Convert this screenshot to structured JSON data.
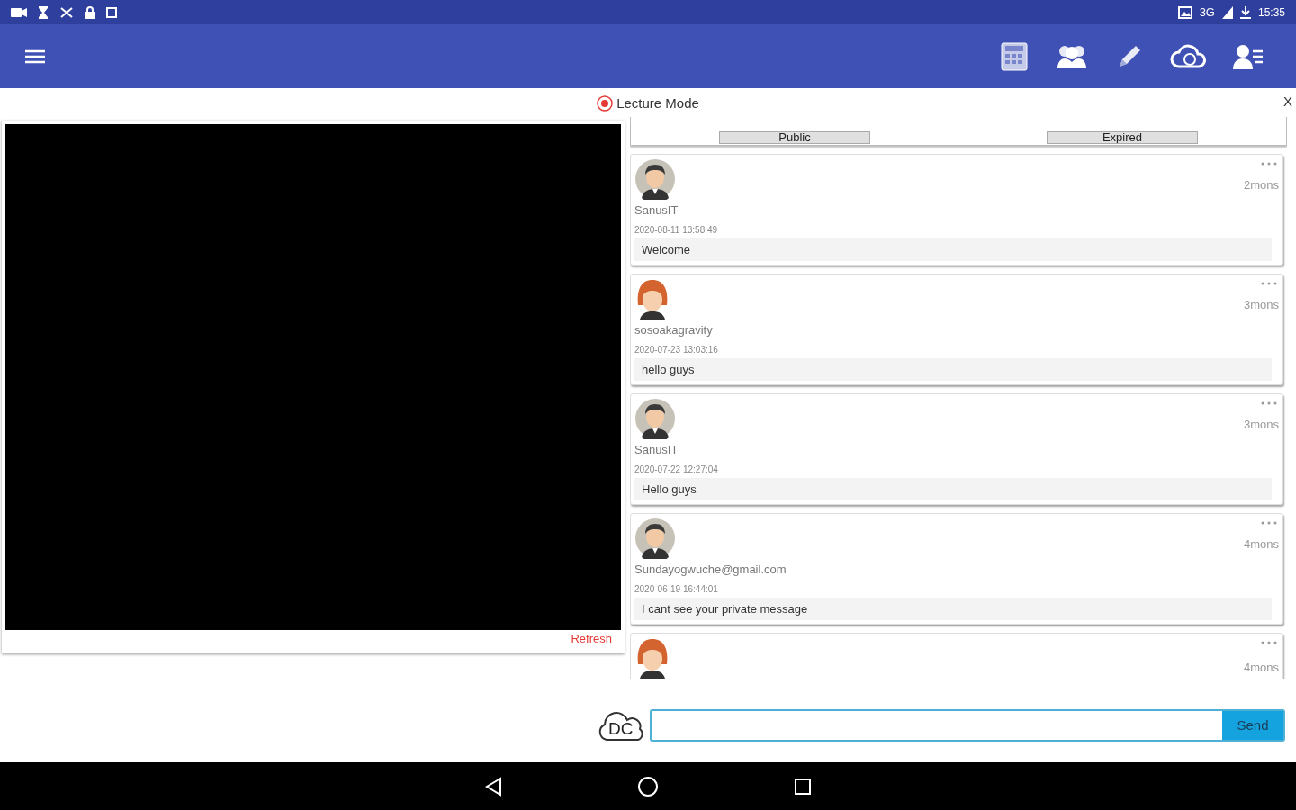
{
  "status_bar": {
    "network": "3G",
    "time": "15:35"
  },
  "dialog": {
    "title": "Lecture Mode",
    "close": "X",
    "recording": true
  },
  "video": {
    "refresh": "Refresh"
  },
  "filter_buttons": [
    "Public",
    "Expired"
  ],
  "posts": [
    {
      "kind": "male",
      "name": "SanusIT",
      "timestamp": "2020-08-11 13:58:49",
      "message": "Welcome",
      "age": "2mons"
    },
    {
      "kind": "female",
      "name": "sosoakagravity",
      "timestamp": "2020-07-23 13:03:16",
      "message": "hello guys",
      "age": "3mons"
    },
    {
      "kind": "male",
      "name": "SanusIT",
      "timestamp": "2020-07-22 12:27:04",
      "message": "Hello guys",
      "age": "3mons"
    },
    {
      "kind": "male",
      "name": "Sundayogwuche@gmail.com",
      "timestamp": "2020-06-19 16:44:01",
      "message": "I cant see your private message",
      "age": "4mons"
    },
    {
      "kind": "female",
      "age": "4mons"
    }
  ],
  "composer": {
    "logo": "DC",
    "send": "Send"
  }
}
